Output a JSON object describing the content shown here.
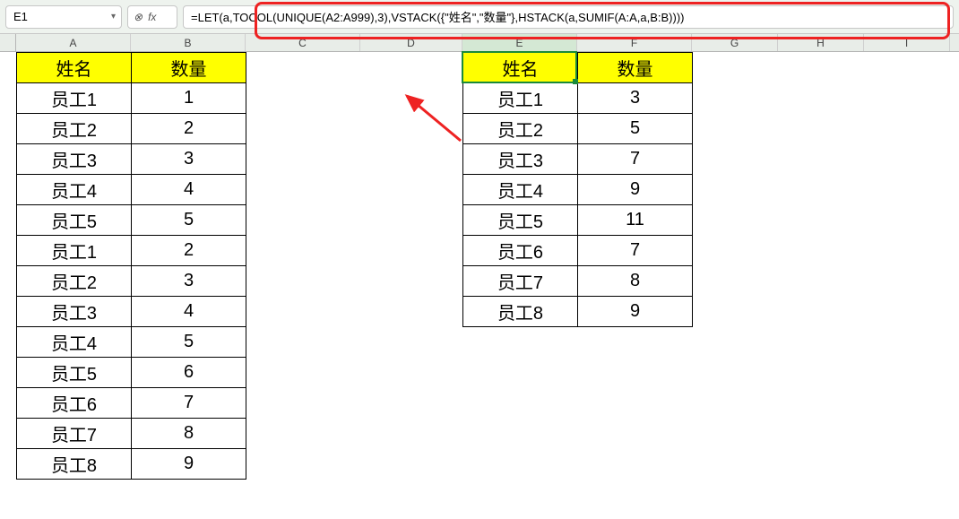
{
  "namebox": {
    "value": "E1"
  },
  "formula": {
    "value": "=LET(a,TOCOL(UNIQUE(A2:A999),3),VSTACK({\"姓名\",\"数量\"},HSTACK(a,SUMIF(A:A,a,B:B))))"
  },
  "columns": {
    "A": "A",
    "B": "B",
    "C": "C",
    "D": "D",
    "E": "E",
    "F": "F",
    "G": "G",
    "H": "H",
    "I": "I"
  },
  "tableAB": {
    "headers": {
      "name": "姓名",
      "qty": "数量"
    },
    "rows": [
      {
        "name": "员工1",
        "qty": "1"
      },
      {
        "name": "员工2",
        "qty": "2"
      },
      {
        "name": "员工3",
        "qty": "3"
      },
      {
        "name": "员工4",
        "qty": "4"
      },
      {
        "name": "员工5",
        "qty": "5"
      },
      {
        "name": "员工1",
        "qty": "2"
      },
      {
        "name": "员工2",
        "qty": "3"
      },
      {
        "name": "员工3",
        "qty": "4"
      },
      {
        "name": "员工4",
        "qty": "5"
      },
      {
        "name": "员工5",
        "qty": "6"
      },
      {
        "name": "员工6",
        "qty": "7"
      },
      {
        "name": "员工7",
        "qty": "8"
      },
      {
        "name": "员工8",
        "qty": "9"
      }
    ]
  },
  "tableEF": {
    "headers": {
      "name": "姓名",
      "qty": "数量"
    },
    "rows": [
      {
        "name": "员工1",
        "qty": "3"
      },
      {
        "name": "员工2",
        "qty": "5"
      },
      {
        "name": "员工3",
        "qty": "7"
      },
      {
        "name": "员工4",
        "qty": "9"
      },
      {
        "name": "员工5",
        "qty": "11"
      },
      {
        "name": "员工6",
        "qty": "7"
      },
      {
        "name": "员工7",
        "qty": "8"
      },
      {
        "name": "员工8",
        "qty": "9"
      }
    ]
  },
  "colors": {
    "highlight": "#e22",
    "selection": "#1a8a3a",
    "headerFill": "#ffff00"
  }
}
